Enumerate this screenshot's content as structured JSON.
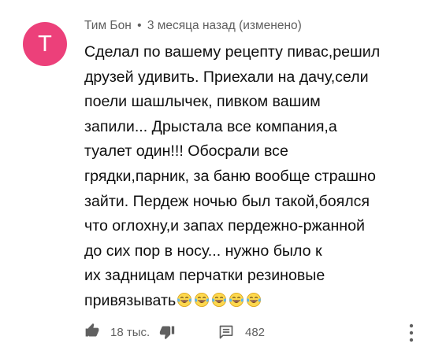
{
  "comment": {
    "avatar_letter": "T",
    "avatar_color": "#ec407a",
    "author": "Тим Бон",
    "separator": "•",
    "time": "3 месяца назад",
    "edited": "(изменено)",
    "lines": [
      "Сделал по вашему рецепту пивас,решил",
      "друзей удивить. Приехали на дачу,сели",
      "поели шашлычек, пивком вашим",
      "запили... Дрыстала все компания,а",
      "туалет один!!! Обосрали все",
      "грядки,парник, за баню вообще страшно",
      "зайти. Пердеж ночью был такой,боялся",
      "что оглохну,и запах пердежно-ржанной",
      "до сих пор в носу...  нужно было  к",
      "их задницам перчатки резиновые",
      "привязывать"
    ],
    "emoji": [
      "laughing-tears",
      "laughing-tears",
      "laughing-tears",
      "laughing-tears",
      "laughing-tears"
    ]
  },
  "actions": {
    "like_icon": "thumb-up-icon",
    "like_count": "18 тыс.",
    "dislike_icon": "thumb-down-icon",
    "reply_icon": "reply-comment-icon",
    "reply_count": "482",
    "more_icon": "more-vertical-icon"
  }
}
